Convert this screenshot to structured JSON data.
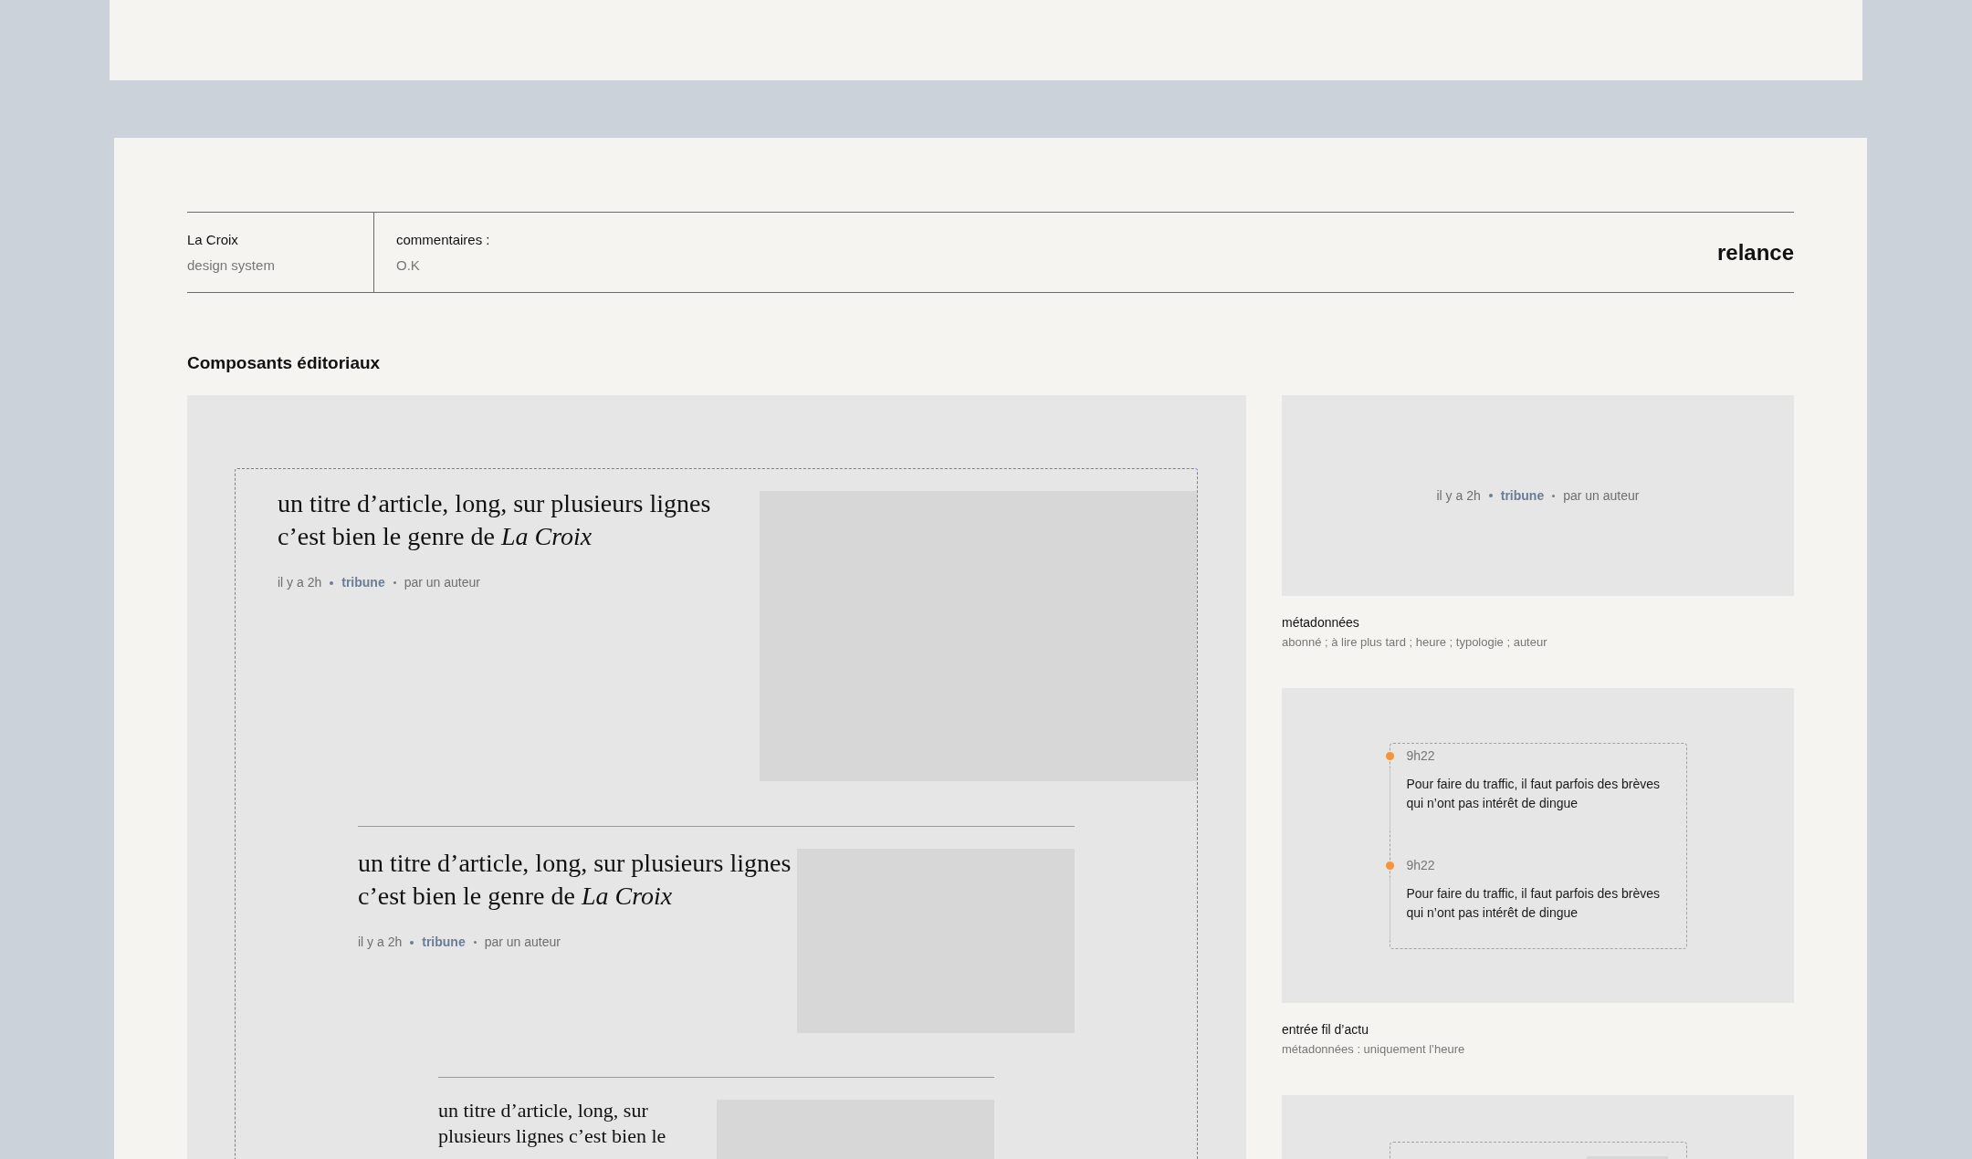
{
  "header": {
    "brand": "La Croix",
    "brand_sub": "design system",
    "comment_label": "commentaires :",
    "comment_value": "O.K",
    "status": "relance"
  },
  "section_title": "Composants éditoriaux",
  "articles": [
    {
      "title": "un titre d’article, long, sur plusieurs lignes c’est bien le genre de *La Croix*",
      "meta": {
        "time": "il y a 2h",
        "type": "tribune",
        "author": "par un auteur"
      }
    },
    {
      "title": "un titre d’article, long, sur plusieurs lignes c’est bien le genre de *La Croix*",
      "meta": {
        "time": "il y a 2h",
        "type": "tribune",
        "author": "par un auteur"
      }
    },
    {
      "title": "un titre d’article, long, sur plusieurs lignes c’est bien le"
    }
  ],
  "specimens": [
    {
      "kind": "metadata",
      "meta": {
        "time": "il y a 2h",
        "type": "tribune",
        "author": "par un auteur"
      },
      "caption": "métadonnées",
      "caption_sub": "abonné ; à lire plus tard ; heure ; typologie ; auteur"
    },
    {
      "kind": "feed",
      "entries": [
        {
          "time": "9h22",
          "text": "Pour faire du traffic, il faut parfois des brèves qui n’ont pas intérêt de dingue",
          "color": "#f7933b"
        },
        {
          "time": "9h22",
          "text": "Pour faire du traffic, il faut parfois des brèves qui n’ont pas intérêt de dingue",
          "color": "#f7933b"
        }
      ],
      "caption": "entrée fil d’actu",
      "caption_sub": "métadonnées : uniquement l’heure"
    },
    {
      "kind": "partial"
    }
  ]
}
